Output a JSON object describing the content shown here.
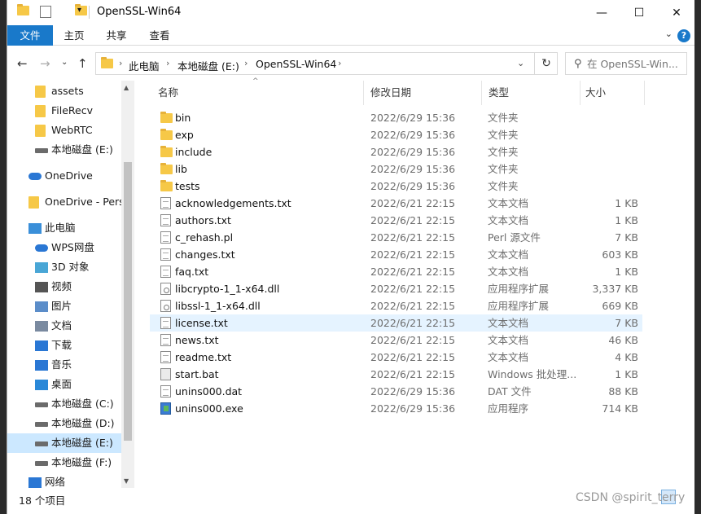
{
  "window": {
    "title": "OpenSSL-Win64",
    "controls": {
      "minimize": "—",
      "maximize": "☐",
      "close": "✕"
    },
    "qa_dropdown": "▾"
  },
  "ribbon": {
    "tabs": [
      "文件",
      "主页",
      "共享",
      "查看"
    ],
    "help": "?",
    "collapse": "⌄"
  },
  "nav_buttons": {
    "back": "←",
    "forward": "→",
    "recent": "⌄",
    "up": "↑"
  },
  "address": {
    "crumbs": [
      "此电脑",
      "本地磁盘 (E:)",
      "OpenSSL-Win64"
    ],
    "separator": "›",
    "dropdown": "⌄",
    "refresh": "↻"
  },
  "search": {
    "placeholder": "在 OpenSSL-Win..."
  },
  "navpane": {
    "items": [
      {
        "label": "assets",
        "icon": "folder-icon"
      },
      {
        "label": "FileRecv",
        "icon": "folder-icon"
      },
      {
        "label": "WebRTC",
        "icon": "folder-icon"
      },
      {
        "label": "本地磁盘 (E:)",
        "icon": "drive-icon"
      },
      {
        "label": "OneDrive",
        "icon": "onedrive-icon"
      },
      {
        "label": "OneDrive - Perso",
        "icon": "folder-icon"
      },
      {
        "label": "此电脑",
        "icon": "computer-icon"
      },
      {
        "label": "WPS网盘",
        "icon": "cloud-icon"
      },
      {
        "label": "3D 对象",
        "icon": "cube-icon"
      },
      {
        "label": "视频",
        "icon": "video-icon"
      },
      {
        "label": "图片",
        "icon": "picture-icon"
      },
      {
        "label": "文档",
        "icon": "document-icon"
      },
      {
        "label": "下载",
        "icon": "download-icon"
      },
      {
        "label": "音乐",
        "icon": "music-icon"
      },
      {
        "label": "桌面",
        "icon": "desktop-icon"
      },
      {
        "label": "本地磁盘 (C:)",
        "icon": "drive-icon"
      },
      {
        "label": "本地磁盘 (D:)",
        "icon": "drive-icon"
      },
      {
        "label": "本地磁盘 (E:)",
        "icon": "drive-icon",
        "selected": true
      },
      {
        "label": "本地磁盘 (F:)",
        "icon": "drive-icon"
      },
      {
        "label": "网络",
        "icon": "network-icon"
      }
    ]
  },
  "columns": {
    "name": "名称",
    "date": "修改日期",
    "type": "类型",
    "size": "大小"
  },
  "files": [
    {
      "name": "bin",
      "date": "2022/6/29 15:36",
      "type": "文件夹",
      "size": "",
      "icon": "folder-icon"
    },
    {
      "name": "exp",
      "date": "2022/6/29 15:36",
      "type": "文件夹",
      "size": "",
      "icon": "folder-icon"
    },
    {
      "name": "include",
      "date": "2022/6/29 15:36",
      "type": "文件夹",
      "size": "",
      "icon": "folder-icon"
    },
    {
      "name": "lib",
      "date": "2022/6/29 15:36",
      "type": "文件夹",
      "size": "",
      "icon": "folder-icon"
    },
    {
      "name": "tests",
      "date": "2022/6/29 15:36",
      "type": "文件夹",
      "size": "",
      "icon": "folder-icon"
    },
    {
      "name": "acknowledgements.txt",
      "date": "2022/6/21 22:15",
      "type": "文本文档",
      "size": "1 KB",
      "icon": "text-file-icon"
    },
    {
      "name": "authors.txt",
      "date": "2022/6/21 22:15",
      "type": "文本文档",
      "size": "1 KB",
      "icon": "text-file-icon"
    },
    {
      "name": "c_rehash.pl",
      "date": "2022/6/21 22:15",
      "type": "Perl 源文件",
      "size": "7 KB",
      "icon": "script-file-icon"
    },
    {
      "name": "changes.txt",
      "date": "2022/6/21 22:15",
      "type": "文本文档",
      "size": "603 KB",
      "icon": "text-file-icon"
    },
    {
      "name": "faq.txt",
      "date": "2022/6/21 22:15",
      "type": "文本文档",
      "size": "1 KB",
      "icon": "text-file-icon"
    },
    {
      "name": "libcrypto-1_1-x64.dll",
      "date": "2022/6/21 22:15",
      "type": "应用程序扩展",
      "size": "3,337 KB",
      "icon": "dll-file-icon"
    },
    {
      "name": "libssl-1_1-x64.dll",
      "date": "2022/6/21 22:15",
      "type": "应用程序扩展",
      "size": "669 KB",
      "icon": "dll-file-icon"
    },
    {
      "name": "license.txt",
      "date": "2022/6/21 22:15",
      "type": "文本文档",
      "size": "7 KB",
      "icon": "text-file-icon",
      "highlight": true
    },
    {
      "name": "news.txt",
      "date": "2022/6/21 22:15",
      "type": "文本文档",
      "size": "46 KB",
      "icon": "text-file-icon"
    },
    {
      "name": "readme.txt",
      "date": "2022/6/21 22:15",
      "type": "文本文档",
      "size": "4 KB",
      "icon": "text-file-icon"
    },
    {
      "name": "start.bat",
      "date": "2022/6/21 22:15",
      "type": "Windows 批处理...",
      "size": "1 KB",
      "icon": "batch-file-icon"
    },
    {
      "name": "unins000.dat",
      "date": "2022/6/29 15:36",
      "type": "DAT 文件",
      "size": "88 KB",
      "icon": "data-file-icon"
    },
    {
      "name": "unins000.exe",
      "date": "2022/6/29 15:36",
      "type": "应用程序",
      "size": "714 KB",
      "icon": "exe-file-icon"
    }
  ],
  "status": {
    "item_count": "18 个项目"
  },
  "watermark": "CSDN @spirit_terry"
}
